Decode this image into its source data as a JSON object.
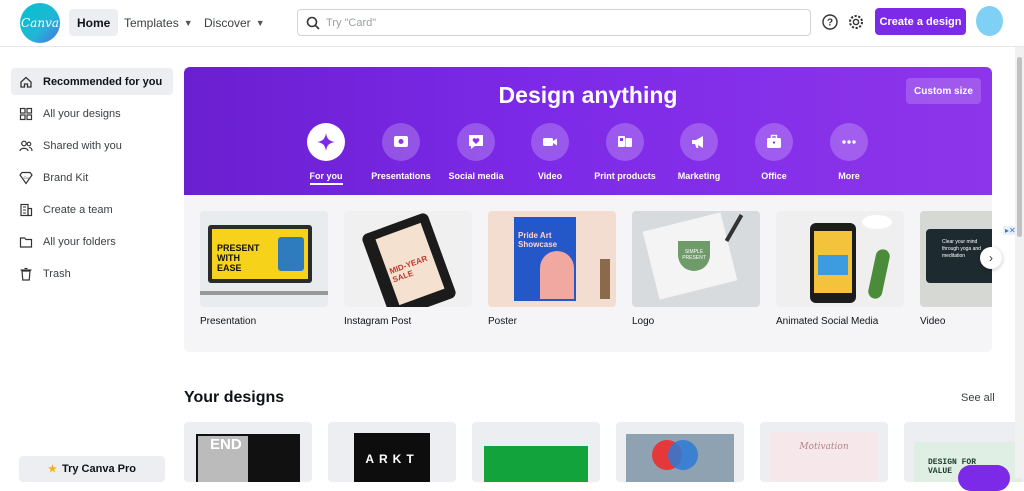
{
  "app": {
    "logo_text": "Canva"
  },
  "topbar": {
    "home": "Home",
    "templates": "Templates",
    "discover": "Discover",
    "search_placeholder": "Try \"Card\"",
    "create_button": "Create a design"
  },
  "sidebar": {
    "items": [
      {
        "label": "Recommended for you",
        "icon": "home-icon"
      },
      {
        "label": "All your designs",
        "icon": "grid-icon"
      },
      {
        "label": "Shared with you",
        "icon": "people-icon"
      },
      {
        "label": "Brand Kit",
        "icon": "brand-kit-icon"
      },
      {
        "label": "Create a team",
        "icon": "building-icon"
      },
      {
        "label": "All your folders",
        "icon": "folder-icon"
      },
      {
        "label": "Trash",
        "icon": "trash-icon"
      }
    ],
    "try_pro": "Try Canva Pro"
  },
  "hero": {
    "title": "Design anything",
    "custom_size": "Custom size",
    "categories": [
      {
        "label": "For you",
        "icon": "sparkle-icon"
      },
      {
        "label": "Presentations",
        "icon": "presentation-icon"
      },
      {
        "label": "Social media",
        "icon": "heart-chat-icon"
      },
      {
        "label": "Video",
        "icon": "video-camera-icon"
      },
      {
        "label": "Print products",
        "icon": "print-icon"
      },
      {
        "label": "Marketing",
        "icon": "megaphone-icon"
      },
      {
        "label": "Office",
        "icon": "briefcase-icon"
      },
      {
        "label": "More",
        "icon": "more-dots-icon"
      }
    ]
  },
  "design_types": [
    {
      "label": "Presentation",
      "thumb_text": "PRESENT WITH EASE"
    },
    {
      "label": "Instagram Post",
      "thumb_text": "MID-YEAR SALE"
    },
    {
      "label": "Poster",
      "thumb_text": "Pride Art Showcase"
    },
    {
      "label": "Logo",
      "thumb_text": "SIMPLE PRESENT"
    },
    {
      "label": "Animated Social Media",
      "thumb_text": ""
    },
    {
      "label": "Video",
      "thumb_text": "Clear your mind through yoga and meditation"
    }
  ],
  "your_designs": {
    "title": "Your designs",
    "see_all": "See all",
    "thumbs": [
      "END",
      "ARKT",
      "",
      "",
      "Motivation",
      "DESIGN FOR VALUE"
    ]
  },
  "colors": {
    "brand_purple": "#7d2ae8",
    "teal": "#00c4cc"
  }
}
